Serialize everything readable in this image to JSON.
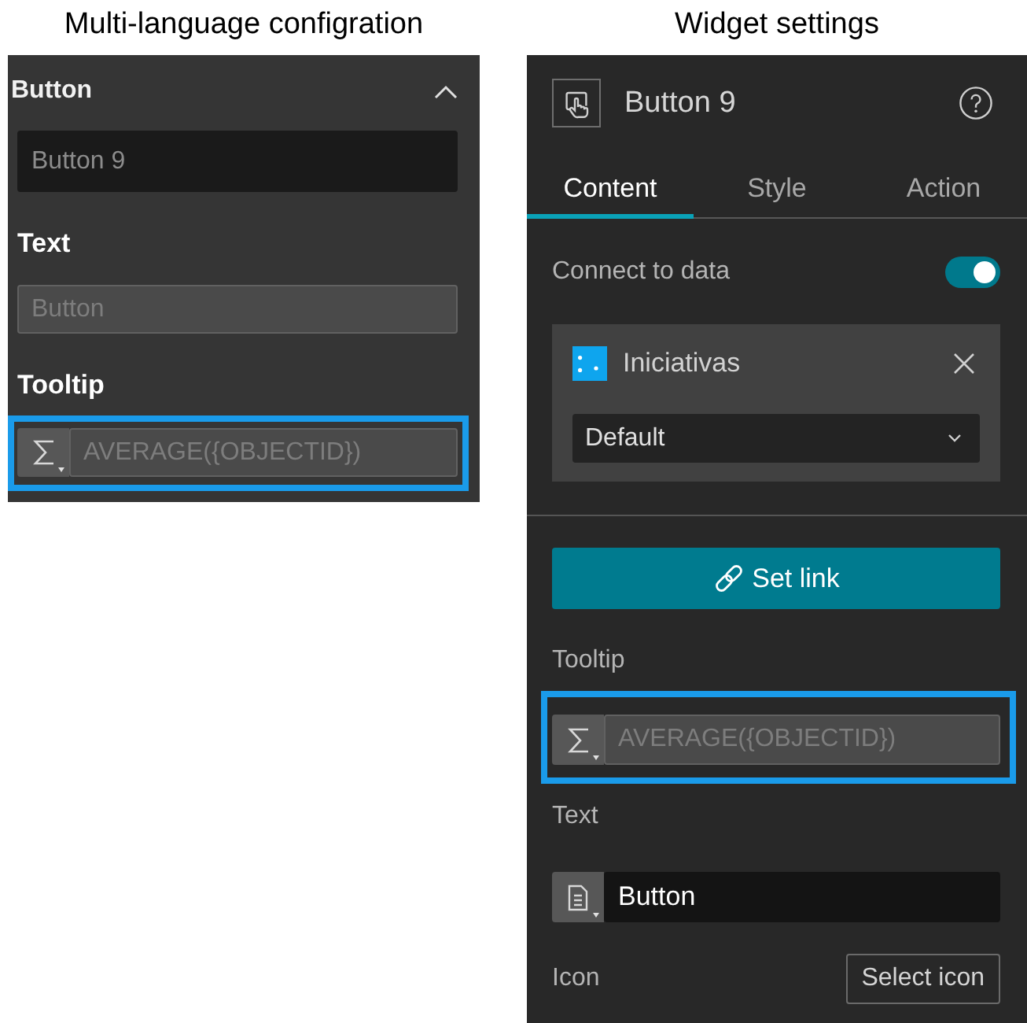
{
  "left": {
    "caption": "Multi-language configration",
    "section": {
      "title": "Button",
      "expanded": true
    },
    "fields": [
      {
        "kind": "plain",
        "placeholder": "Button 9",
        "disabled": false,
        "highlighted": false
      },
      {
        "label": "Text",
        "kind": "plain",
        "placeholder": "Button",
        "disabled": true,
        "highlighted": false
      },
      {
        "label": "Tooltip",
        "kind": "expression",
        "placeholder": "AVERAGE({OBJECTID})",
        "disabled": true,
        "highlighted": true
      }
    ]
  },
  "right": {
    "caption": "Widget settings",
    "header": {
      "title": "Button 9"
    },
    "tabs": [
      {
        "label": "Content",
        "selected": true
      },
      {
        "label": "Style",
        "selected": false
      },
      {
        "label": "Action",
        "selected": false
      }
    ],
    "connect_to_data": {
      "label": "Connect to data",
      "on": true
    },
    "data_source": {
      "name": "Iniciativas",
      "view": "Default"
    },
    "set_link_button": {
      "label": "Set link"
    },
    "fields": [
      {
        "label": "Tooltip",
        "kind": "expression",
        "placeholder": "AVERAGE({OBJECTID})",
        "disabled": true,
        "highlighted": true
      },
      {
        "label": "Text",
        "kind": "document",
        "value": "Button",
        "disabled": false,
        "highlighted": false
      }
    ],
    "icon_row": {
      "label": "Icon",
      "button": "Select icon"
    }
  }
}
